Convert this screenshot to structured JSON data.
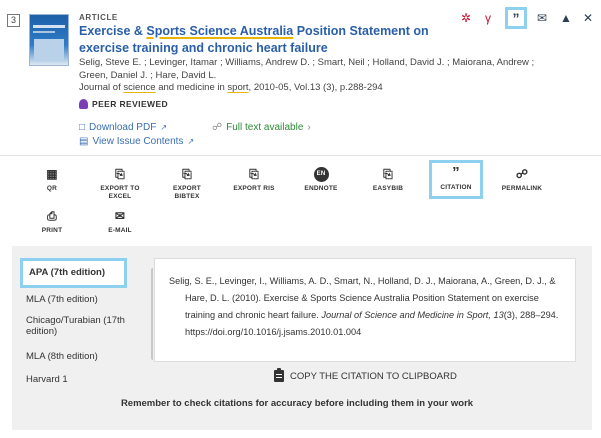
{
  "record": {
    "number": "3",
    "type": "ARTICLE",
    "title_parts": [
      "Exercise & ",
      "Sports Science Australia",
      " Position Statement on exercise training and chronic heart failure"
    ],
    "authors": "Selig, Steve E. ; Levinger, Itamar ; Williams, Andrew D. ; Smart, Neil ; Holland, David J. ; Maiorana, Andrew ; Green, Daniel J. ; Hare, David L.",
    "journal_parts": [
      "Journal of ",
      "science",
      " and medicine in ",
      "sport",
      ", 2010-05, Vol.13 (3), p.288-294"
    ],
    "peer_reviewed": "PEER REVIEWED",
    "download_pdf": "Download PDF",
    "view_issue": "View Issue Contents",
    "full_text": "Full text available"
  },
  "top_actions": [
    {
      "name": "mendeley-icon",
      "glyph": "♈"
    },
    {
      "name": "zotero-icon",
      "glyph": "♈"
    },
    {
      "name": "citation-quote-icon",
      "glyph": "”"
    },
    {
      "name": "email-icon",
      "glyph": "✉"
    },
    {
      "name": "pin-icon",
      "glyph": "📌"
    },
    {
      "name": "close-icon",
      "glyph": "✕"
    }
  ],
  "actions": [
    {
      "label": "QR",
      "glyph": "▦",
      "name": "qr"
    },
    {
      "label": "EXPORT TO EXCEL",
      "glyph": "✒",
      "name": "export-excel"
    },
    {
      "label": "EXPORT BIBTEX",
      "glyph": "✒",
      "name": "export-bibtex"
    },
    {
      "label": "EXPORT RIS",
      "glyph": "✒",
      "name": "export-ris"
    },
    {
      "label": "ENDNOTE",
      "glyph": "EN",
      "name": "endnote"
    },
    {
      "label": "EASYBIB",
      "glyph": "✒",
      "name": "easybib"
    },
    {
      "label": "CITATION",
      "glyph": "”",
      "name": "citation"
    },
    {
      "label": "PERMALINK",
      "glyph": "☍",
      "name": "permalink"
    },
    {
      "label": "PRINT",
      "glyph": "⎙",
      "name": "print"
    },
    {
      "label": "E-MAIL",
      "glyph": "✉",
      "name": "email"
    }
  ],
  "citation_styles": [
    "APA (7th edition)",
    "MLA (7th edition)",
    "Chicago/Turabian (17th edition)",
    "MLA (8th edition)",
    "Harvard 1"
  ],
  "citation": {
    "part1": "Selig, S. E., Levinger, I., Williams, A. D., Smart, N., Holland, D. J., Maiorana, A., Green, D. J., & Hare, D. L. (2010). Exercise & Sports Science Australia Position Statement on exercise training and chronic heart failure. ",
    "journal": "Journal of Science and Medicine in Sport, 13",
    "part2": "(3), 288–294. https://doi.org/10.1016/j.jsams.2010.01.004"
  },
  "copy_label": "COPY THE CITATION TO CLIPBOARD",
  "reminder": "Remember to check citations for accuracy before including them in your work",
  "colors": {
    "link": "#3a6fb0",
    "title": "#2a5fa8",
    "highlight_box": "#8ed0f0",
    "full_text": "#2f8a38"
  }
}
